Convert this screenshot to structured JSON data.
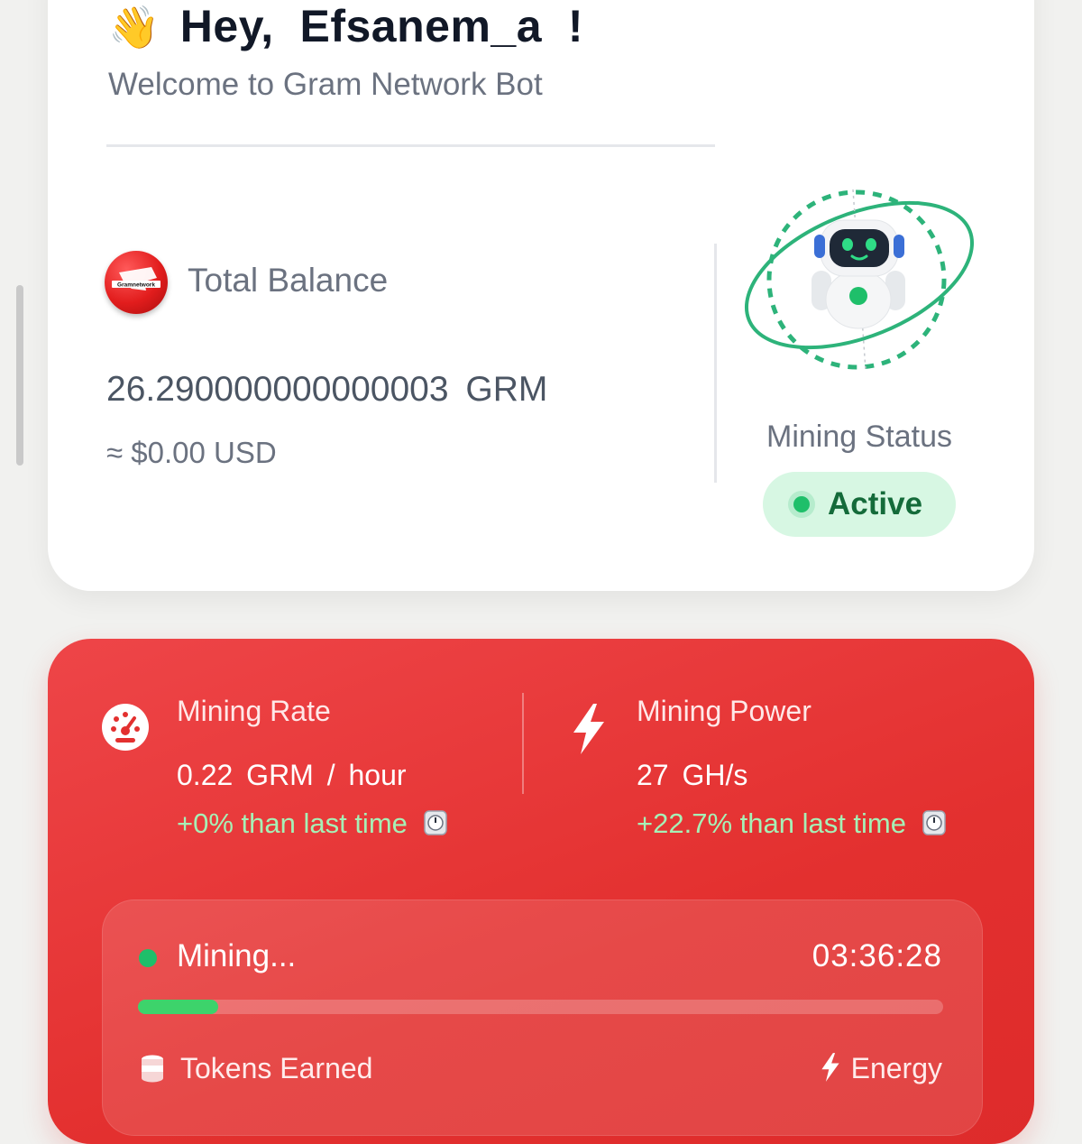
{
  "header": {
    "greeting_prefix": "Hey,",
    "username": "Efsanem_a",
    "greeting_suffix": "!",
    "subtitle": "Welcome to Gram Network Bot"
  },
  "balance": {
    "logo_icon": "gram-network-logo-icon",
    "logo_text": "Gramnetwork",
    "label": "Total Balance",
    "amount": "26.290000000000003 GRM",
    "usd": "≈ $0.00 USD"
  },
  "mining_status": {
    "label": "Mining Status",
    "status": "Active",
    "status_color": "#1fbf6a"
  },
  "stats": {
    "rate": {
      "icon": "speedometer-icon",
      "label": "Mining Rate",
      "value": "0.22 GRM / hour",
      "change": "+0% than last time"
    },
    "power": {
      "icon": "lightning-icon",
      "label": "Mining Power",
      "value": "27 GH/s",
      "change": "+22.7% than last time"
    }
  },
  "session": {
    "status": "Mining...",
    "timer": "03:36:28",
    "progress_percent": 10,
    "tokens_label": "Tokens Earned",
    "energy_label": "Energy"
  },
  "colors": {
    "accent_red": "#e3302f",
    "success_green": "#1fbf6a",
    "progress_green": "#3dd36b"
  }
}
